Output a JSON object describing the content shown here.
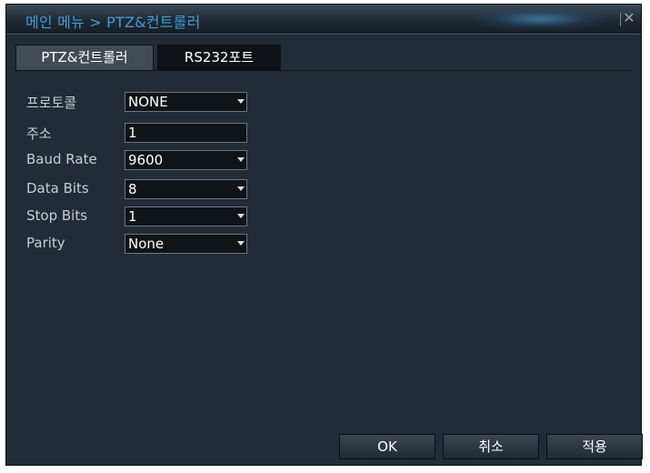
{
  "window": {
    "title": "메인 메뉴 > PTZ&컨트롤러"
  },
  "tabs": [
    {
      "label": "PTZ&컨트롤러",
      "active": true
    },
    {
      "label": "RS232포트",
      "active": false
    }
  ],
  "form": {
    "protocol": {
      "label": "프로토콜",
      "value": "NONE"
    },
    "address": {
      "label": "주소",
      "value": "1"
    },
    "baud_rate": {
      "label": "Baud Rate",
      "value": "9600"
    },
    "data_bits": {
      "label": "Data Bits",
      "value": "8"
    },
    "stop_bits": {
      "label": "Stop Bits",
      "value": "1"
    },
    "parity": {
      "label": "Parity",
      "value": "None"
    }
  },
  "buttons": {
    "ok": "OK",
    "cancel": "취소",
    "apply": "적용"
  },
  "icons": {
    "close": "close-icon",
    "dropdown": "chevron-down-icon"
  },
  "colors": {
    "title_text": "#3f9ddb",
    "background": "#212c37"
  }
}
